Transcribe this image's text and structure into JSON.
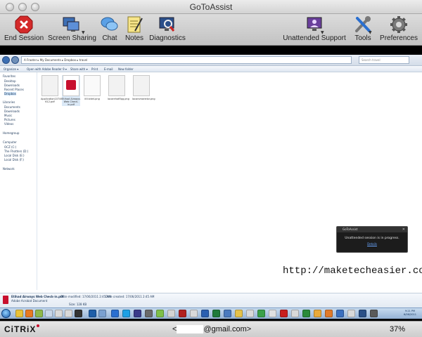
{
  "window": {
    "title": "GoToAssist"
  },
  "toolbar": {
    "end_session": "End Session",
    "screen_sharing": "Screen Sharing",
    "chat": "Chat",
    "notes": "Notes",
    "diagnostics": "Diagnostics",
    "unattended_support": "Unattended Support",
    "tools": "Tools",
    "preferences": "Preferences"
  },
  "remote": {
    "address_path": "A Fraoter ▸ My Documents ▸ Dropbox ▸ travel",
    "search_placeholder": "Search travel",
    "commands": [
      "Organize ▾",
      "Open with Adobe Reader 9 ▾",
      "Share with ▾",
      "Print",
      "E-mail",
      "New folder"
    ],
    "nav_items": [
      {
        "label": "Favorites",
        "indent": 0
      },
      {
        "label": "Desktop",
        "indent": 1
      },
      {
        "label": "Downloads",
        "indent": 1
      },
      {
        "label": "Recent Places",
        "indent": 1
      },
      {
        "label": "Dropbox",
        "indent": 1
      },
      {
        "label": "Libraries",
        "indent": 0
      },
      {
        "label": "Documents",
        "indent": 1
      },
      {
        "label": "Downloads",
        "indent": 1
      },
      {
        "label": "Music",
        "indent": 1
      },
      {
        "label": "Pictures",
        "indent": 1
      },
      {
        "label": "Videos",
        "indent": 1
      },
      {
        "label": "Homegroup",
        "indent": 0
      },
      {
        "label": "Computer",
        "indent": 0
      },
      {
        "label": "OCZ (C:)",
        "indent": 1
      },
      {
        "label": "The Fhotters (D:)",
        "indent": 1
      },
      {
        "label": "Local Disk (E:)",
        "indent": 1
      },
      {
        "label": "Local Disk (F:)",
        "indent": 1
      },
      {
        "label": "Network",
        "indent": 0
      }
    ],
    "files": [
      {
        "name": "Application10746 612.pdf"
      },
      {
        "name": "Etihad Airways Web Check-in.pdf"
      },
      {
        "name": "iif-ticket.png"
      },
      {
        "name": "locarehotflpg.png"
      },
      {
        "name": "locarsmarielor.png"
      }
    ],
    "details": {
      "filename": "Etihad Airways Web Check-in.pdf",
      "modified": "Date modified: 17/06/2011 2:45 AM",
      "created": "Date created: 17/06/2011 2:45 AM",
      "type": "Adobe Acrobat Document",
      "size": "Size: 128 KB"
    },
    "notification": {
      "title": "GoToAssist",
      "message": "Unattended session is in progress.",
      "link": "Details"
    },
    "clock": {
      "time": "9:21 PM",
      "date": "6/06/2011"
    }
  },
  "watermark": "http://maketecheasier.com",
  "footer": {
    "brand": "CiTRiX",
    "session_prefix": "<",
    "session_suffix": "@gmail.com>",
    "zoom": "37%"
  },
  "colors": {
    "end_session_red": "#d42a2a",
    "toolbar_bg": "#cfcfcf",
    "citrix_red": "#c8102e"
  }
}
